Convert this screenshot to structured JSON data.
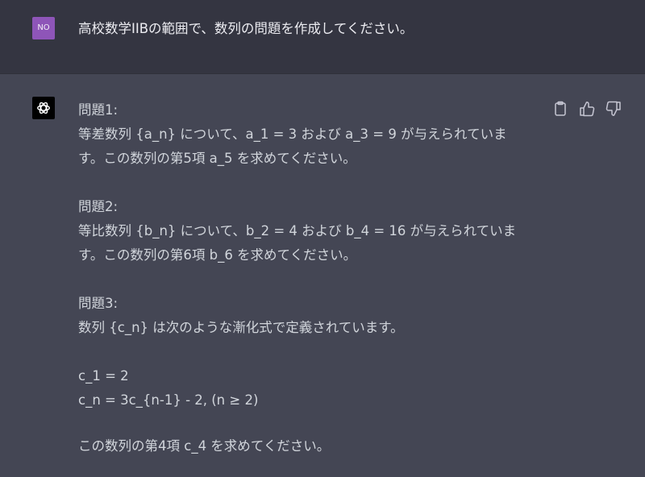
{
  "user_message": {
    "avatar_initials": "NO",
    "avatar_color": "#8e55b8",
    "text": "高校数学IIBの範囲で、数列の問題を作成してください。"
  },
  "assistant_message": {
    "avatar_icon": "openai-logo-icon",
    "actions": [
      {
        "name": "copy-icon"
      },
      {
        "name": "thumbs-up-icon"
      },
      {
        "name": "thumbs-down-icon"
      }
    ],
    "problem1": {
      "heading": "問題1:",
      "line1": "等差数列 {a_n} について、a_1 = 3 および a_3 = 9 が与えられていま",
      "line2": "す。この数列の第5項 a_5 を求めてください。"
    },
    "problem2": {
      "heading": "問題2:",
      "line1": "等比数列 {b_n} について、b_2 = 4 および b_4 = 16 が与えられていま",
      "line2": "す。この数列の第6項 b_6 を求めてください。"
    },
    "problem3": {
      "heading": "問題3:",
      "line1": "数列 {c_n} は次のような漸化式で定義されています。",
      "formula1": "c_1 = 2",
      "formula2": "c_n = 3c_{n-1} - 2, (n ≥ 2)",
      "question": "この数列の第4項 c_4 を求めてください。"
    }
  }
}
